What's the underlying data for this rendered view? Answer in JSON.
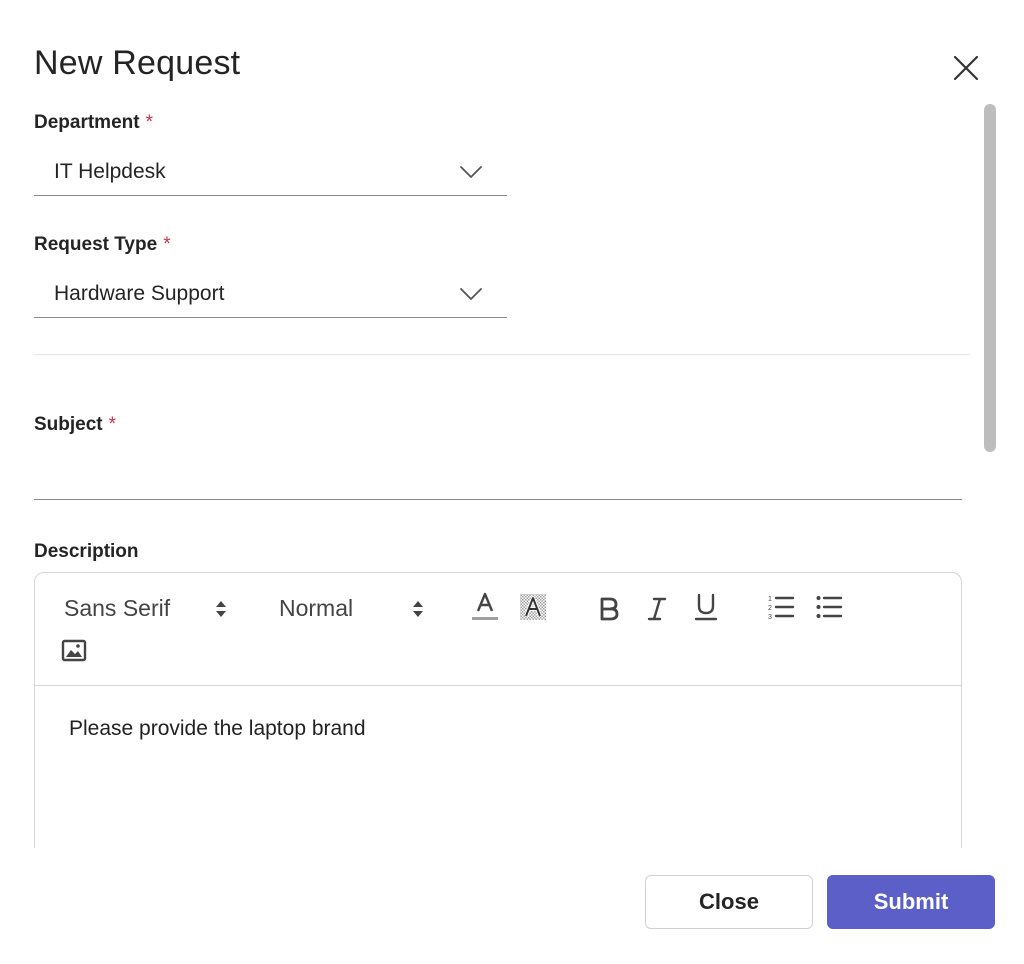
{
  "dialog": {
    "title": "New Request"
  },
  "form": {
    "department": {
      "label": "Department",
      "required_mark": "*",
      "value": "IT Helpdesk"
    },
    "request_type": {
      "label": "Request Type",
      "required_mark": "*",
      "value": "Hardware Support"
    },
    "subject": {
      "label": "Subject",
      "required_mark": "*",
      "value": ""
    },
    "description": {
      "label": "Description",
      "font_family": "Sans Serif",
      "font_size": "Normal",
      "content": "Please provide the laptop brand",
      "toolbar_icons": [
        "font-color-icon",
        "highlight-icon",
        "bold-icon",
        "italic-icon",
        "underline-icon",
        "ordered-list-icon",
        "bullet-list-icon",
        "image-icon"
      ]
    }
  },
  "footer": {
    "close_label": "Close",
    "submit_label": "Submit"
  },
  "colors": {
    "accent": "#5b5fc7",
    "required": "#c4314b"
  }
}
